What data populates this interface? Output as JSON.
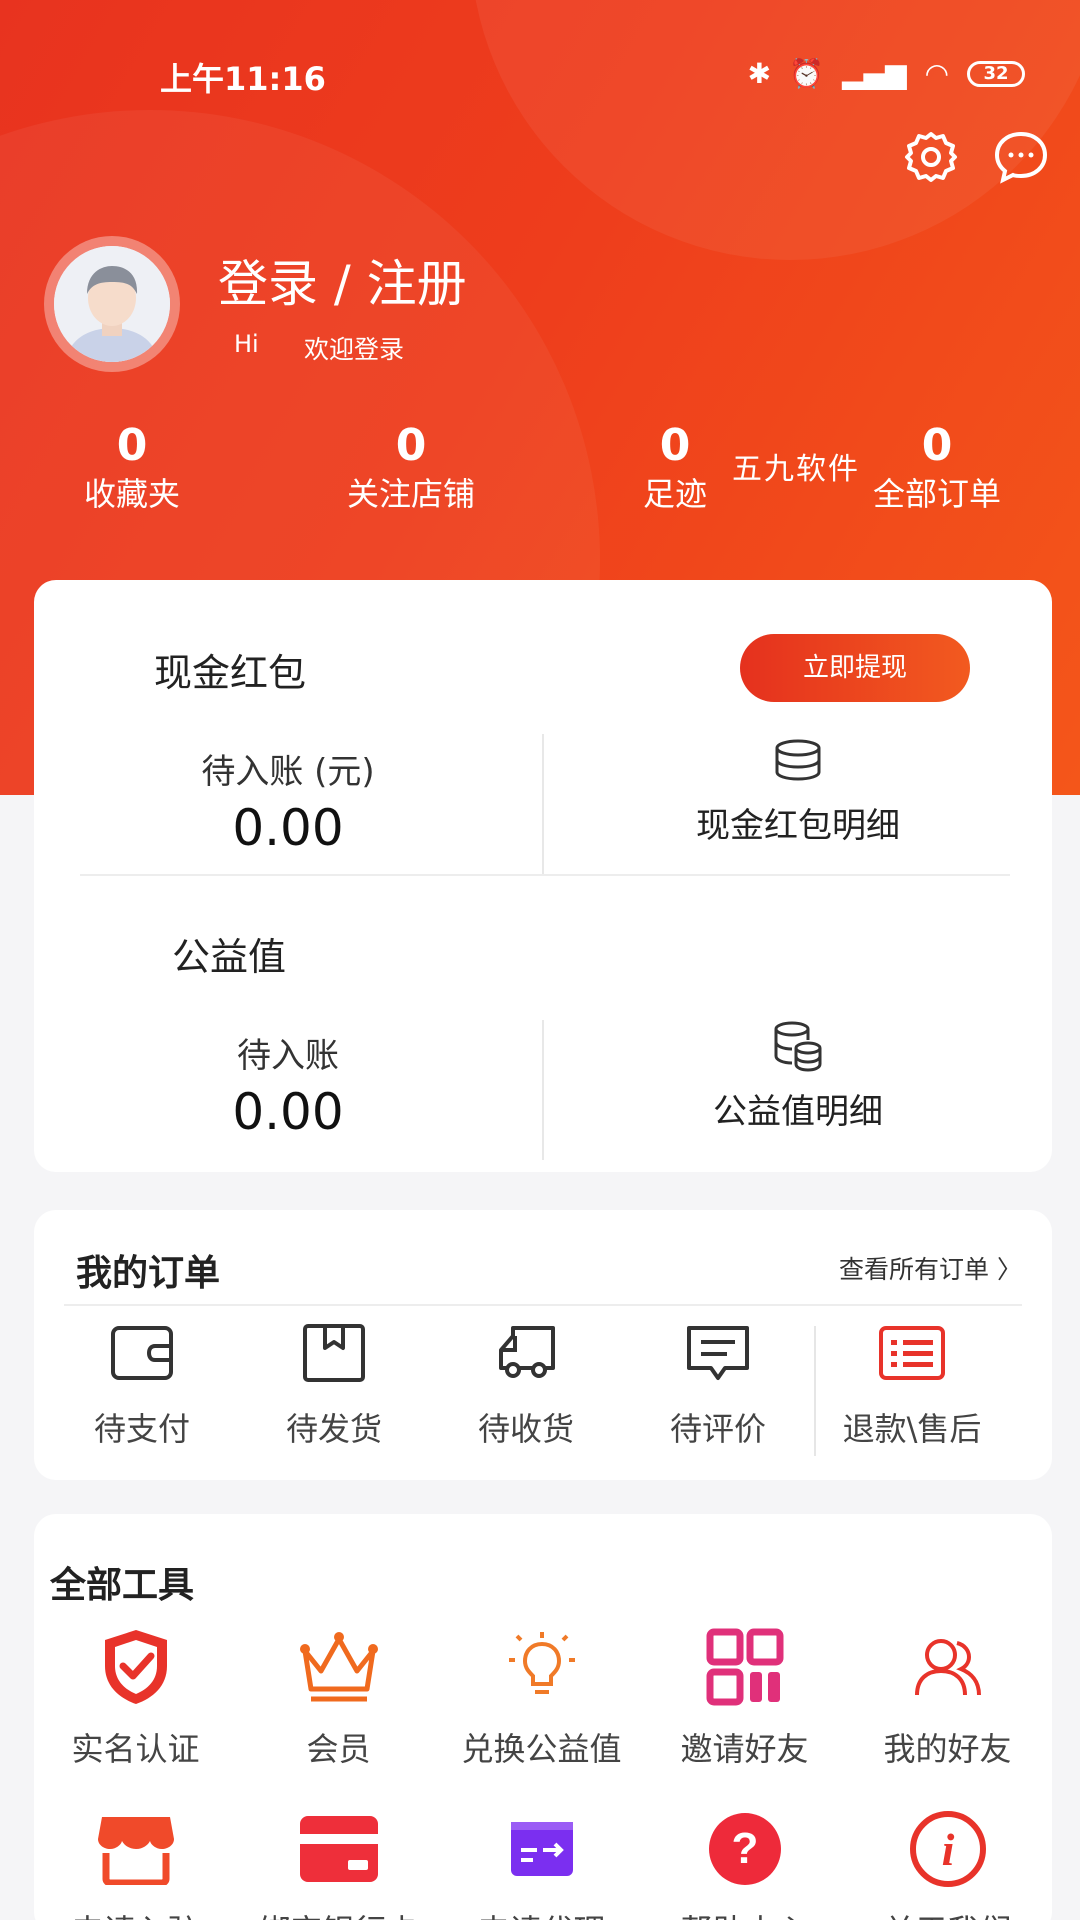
{
  "status_bar": {
    "time": "上午11:16",
    "battery": "32"
  },
  "profile": {
    "title": "登录 / 注册",
    "hi": "Hi",
    "welcome": "欢迎登录"
  },
  "stats": [
    {
      "value": "0",
      "label": "收藏夹"
    },
    {
      "value": "0",
      "label": "关注店铺"
    },
    {
      "value": "0",
      "label": "足迹"
    },
    {
      "value": "0",
      "label": "全部订单"
    }
  ],
  "watermark": "五九软件",
  "cash_card": {
    "title": "现金红包",
    "withdraw_label": "立即提现",
    "pending_label": "待入账 (元)",
    "pending_amount": "0.00",
    "detail_label": "现金红包明细"
  },
  "charity": {
    "title": "公益值",
    "pending_label": "待入账",
    "pending_amount": "0.00",
    "detail_label": "公益值明细"
  },
  "orders": {
    "title": "我的订单",
    "view_all": "查看所有订单 〉",
    "items": [
      {
        "label": "待支付",
        "icon": "wallet-icon"
      },
      {
        "label": "待发货",
        "icon": "box-icon"
      },
      {
        "label": "待收货",
        "icon": "truck-icon"
      },
      {
        "label": "待评价",
        "icon": "comment-icon"
      },
      {
        "label": "退款\\售后",
        "icon": "refund-list-icon"
      }
    ]
  },
  "tools": {
    "title": "全部工具",
    "row1": [
      {
        "label": "实名认证",
        "icon": "shield-check-icon",
        "color": "#e8332a"
      },
      {
        "label": "会员",
        "icon": "crown-icon",
        "color": "#f06a1e"
      },
      {
        "label": "兑换公益值",
        "icon": "lightbulb-icon",
        "color": "#f07a28"
      },
      {
        "label": "邀请好友",
        "icon": "qrcode-icon",
        "color": "#e0307a"
      },
      {
        "label": "我的好友",
        "icon": "friends-icon",
        "color": "#e8332a"
      }
    ],
    "row2": [
      {
        "label": "申请入驻",
        "icon": "shop-icon",
        "color": "#f04a2a"
      },
      {
        "label": "绑定银行卡",
        "icon": "bank-card-icon",
        "color": "#ee2f3a"
      },
      {
        "label": "申请代理",
        "icon": "agent-card-icon",
        "color": "#7b2ff0"
      },
      {
        "label": "帮助中心",
        "icon": "help-icon",
        "color": "#ee2a3a"
      },
      {
        "label": "关于我们",
        "icon": "info-icon",
        "color": "#e8332a"
      }
    ]
  }
}
